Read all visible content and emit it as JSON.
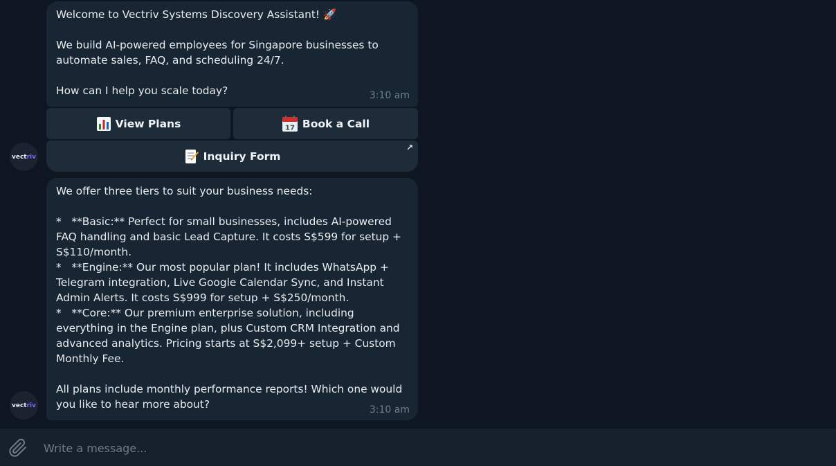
{
  "messages": [
    {
      "lines": [
        "Welcome to Vectriv Systems Discovery Assistant! 🚀",
        "",
        "We build AI-powered employees for Singapore businesses to",
        "automate sales, FAQ, and scheduling 24/7.",
        "",
        "How can I help you scale today?"
      ],
      "time": "3:10 am"
    },
    {
      "lines": [
        "We offer three tiers to suit your business needs:",
        "",
        "*   **Basic:** Perfect for small businesses, includes AI-powered",
        "FAQ handling and basic Lead Capture. It costs S$599 for setup +",
        "S$110/month.",
        "*   **Engine:** Our most popular plan! It includes WhatsApp +",
        "Telegram integration, Live Google Calendar Sync, and Instant",
        "Admin Alerts. It costs S$999 for setup + S$250/month.",
        "*   **Core:** Our premium enterprise solution, including",
        "everything in the Engine plan, plus Custom CRM Integration and",
        "advanced analytics. Pricing starts at S$2,099+ setup + Custom",
        "Monthly Fee.",
        "",
        "All plans include monthly performance reports! Which one would",
        "you like to hear more about?"
      ],
      "time": "3:10 am"
    }
  ],
  "keyboard": {
    "view_plans": "View Plans",
    "book_call": "Book a Call",
    "inquiry_form": "Inquiry Form"
  },
  "avatar": {
    "prefix": "vect",
    "accent": "riv"
  },
  "composer": {
    "placeholder": "Write a message..."
  },
  "icons": {
    "view_plans": "bar-chart-icon",
    "book_call": "calendar-icon",
    "inquiry_form": "memo-icon",
    "inquiry_form_link": "arrow-up-right-icon",
    "attach": "paperclip-icon"
  },
  "colors": {
    "background": "#0e1621",
    "bubble": "#182533",
    "button": "#1e2c3a",
    "composer": "#17212b",
    "timestamp": "#6d7f8f"
  }
}
